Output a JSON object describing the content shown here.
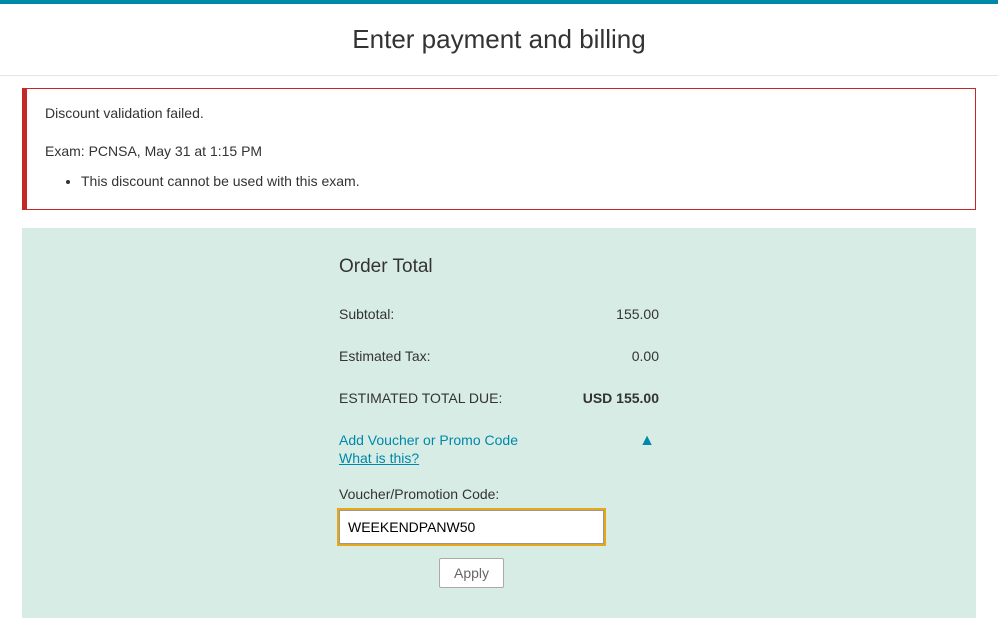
{
  "page": {
    "title": "Enter payment and billing"
  },
  "error": {
    "title": "Discount validation failed.",
    "exam_line": "Exam: PCNSA, May 31 at 1:15 PM",
    "reasons": [
      "This discount cannot be used with this exam."
    ]
  },
  "order": {
    "heading": "Order Total",
    "subtotal_label": "Subtotal:",
    "subtotal_value": "155.00",
    "tax_label": "Estimated Tax:",
    "tax_value": "0.00",
    "total_label": "ESTIMATED TOTAL DUE:",
    "total_value": "USD 155.00"
  },
  "voucher": {
    "add_link": "Add Voucher or Promo Code",
    "what_link": "What is this?",
    "field_label": "Voucher/Promotion Code:",
    "field_value": "WEEKENDPANW50",
    "apply_label": "Apply"
  }
}
